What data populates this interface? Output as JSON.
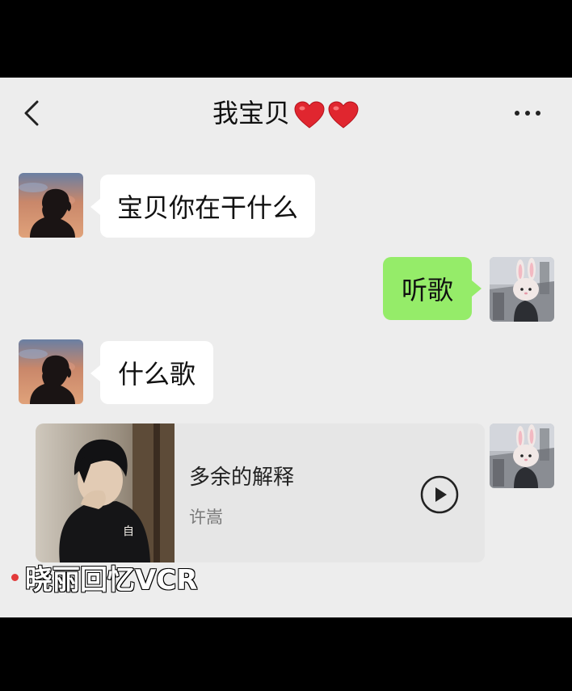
{
  "header": {
    "title": "我宝贝",
    "title_emoji": [
      "heart-icon",
      "heart-icon"
    ],
    "back_icon": "chevron-left-icon",
    "more_icon": "more-icon"
  },
  "messages": [
    {
      "side": "left",
      "text": "宝贝你在干什么"
    },
    {
      "side": "right",
      "text": "听歌"
    },
    {
      "side": "left",
      "text": "什么歌"
    }
  ],
  "music_card": {
    "title": "多余的解释",
    "artist": "许嵩",
    "cover_text": "自"
  },
  "watermark": {
    "text": "晓丽回忆VCR"
  },
  "colors": {
    "chat_bg": "#ededed",
    "bubble_left": "#ffffff",
    "bubble_right": "#95ec69",
    "heart": "#e0262f"
  }
}
